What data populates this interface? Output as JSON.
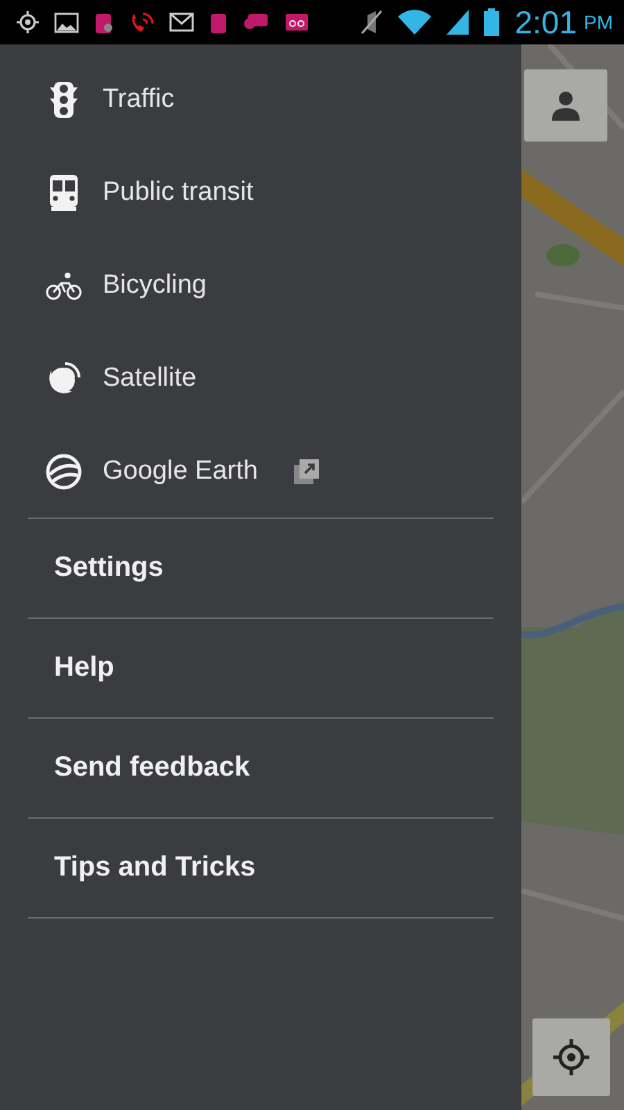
{
  "status_bar": {
    "time": "2:01",
    "am_pm": "PM"
  },
  "layers": [
    {
      "kind": "traffic",
      "label": "Traffic",
      "external": false
    },
    {
      "kind": "transit",
      "label": "Public transit",
      "external": false
    },
    {
      "kind": "bicycling",
      "label": "Bicycling",
      "external": false
    },
    {
      "kind": "satellite",
      "label": "Satellite",
      "external": false
    },
    {
      "kind": "earth",
      "label": "Google Earth",
      "external": true
    }
  ],
  "menu": [
    "Settings",
    "Help",
    "Send feedback",
    "Tips and Tricks"
  ]
}
